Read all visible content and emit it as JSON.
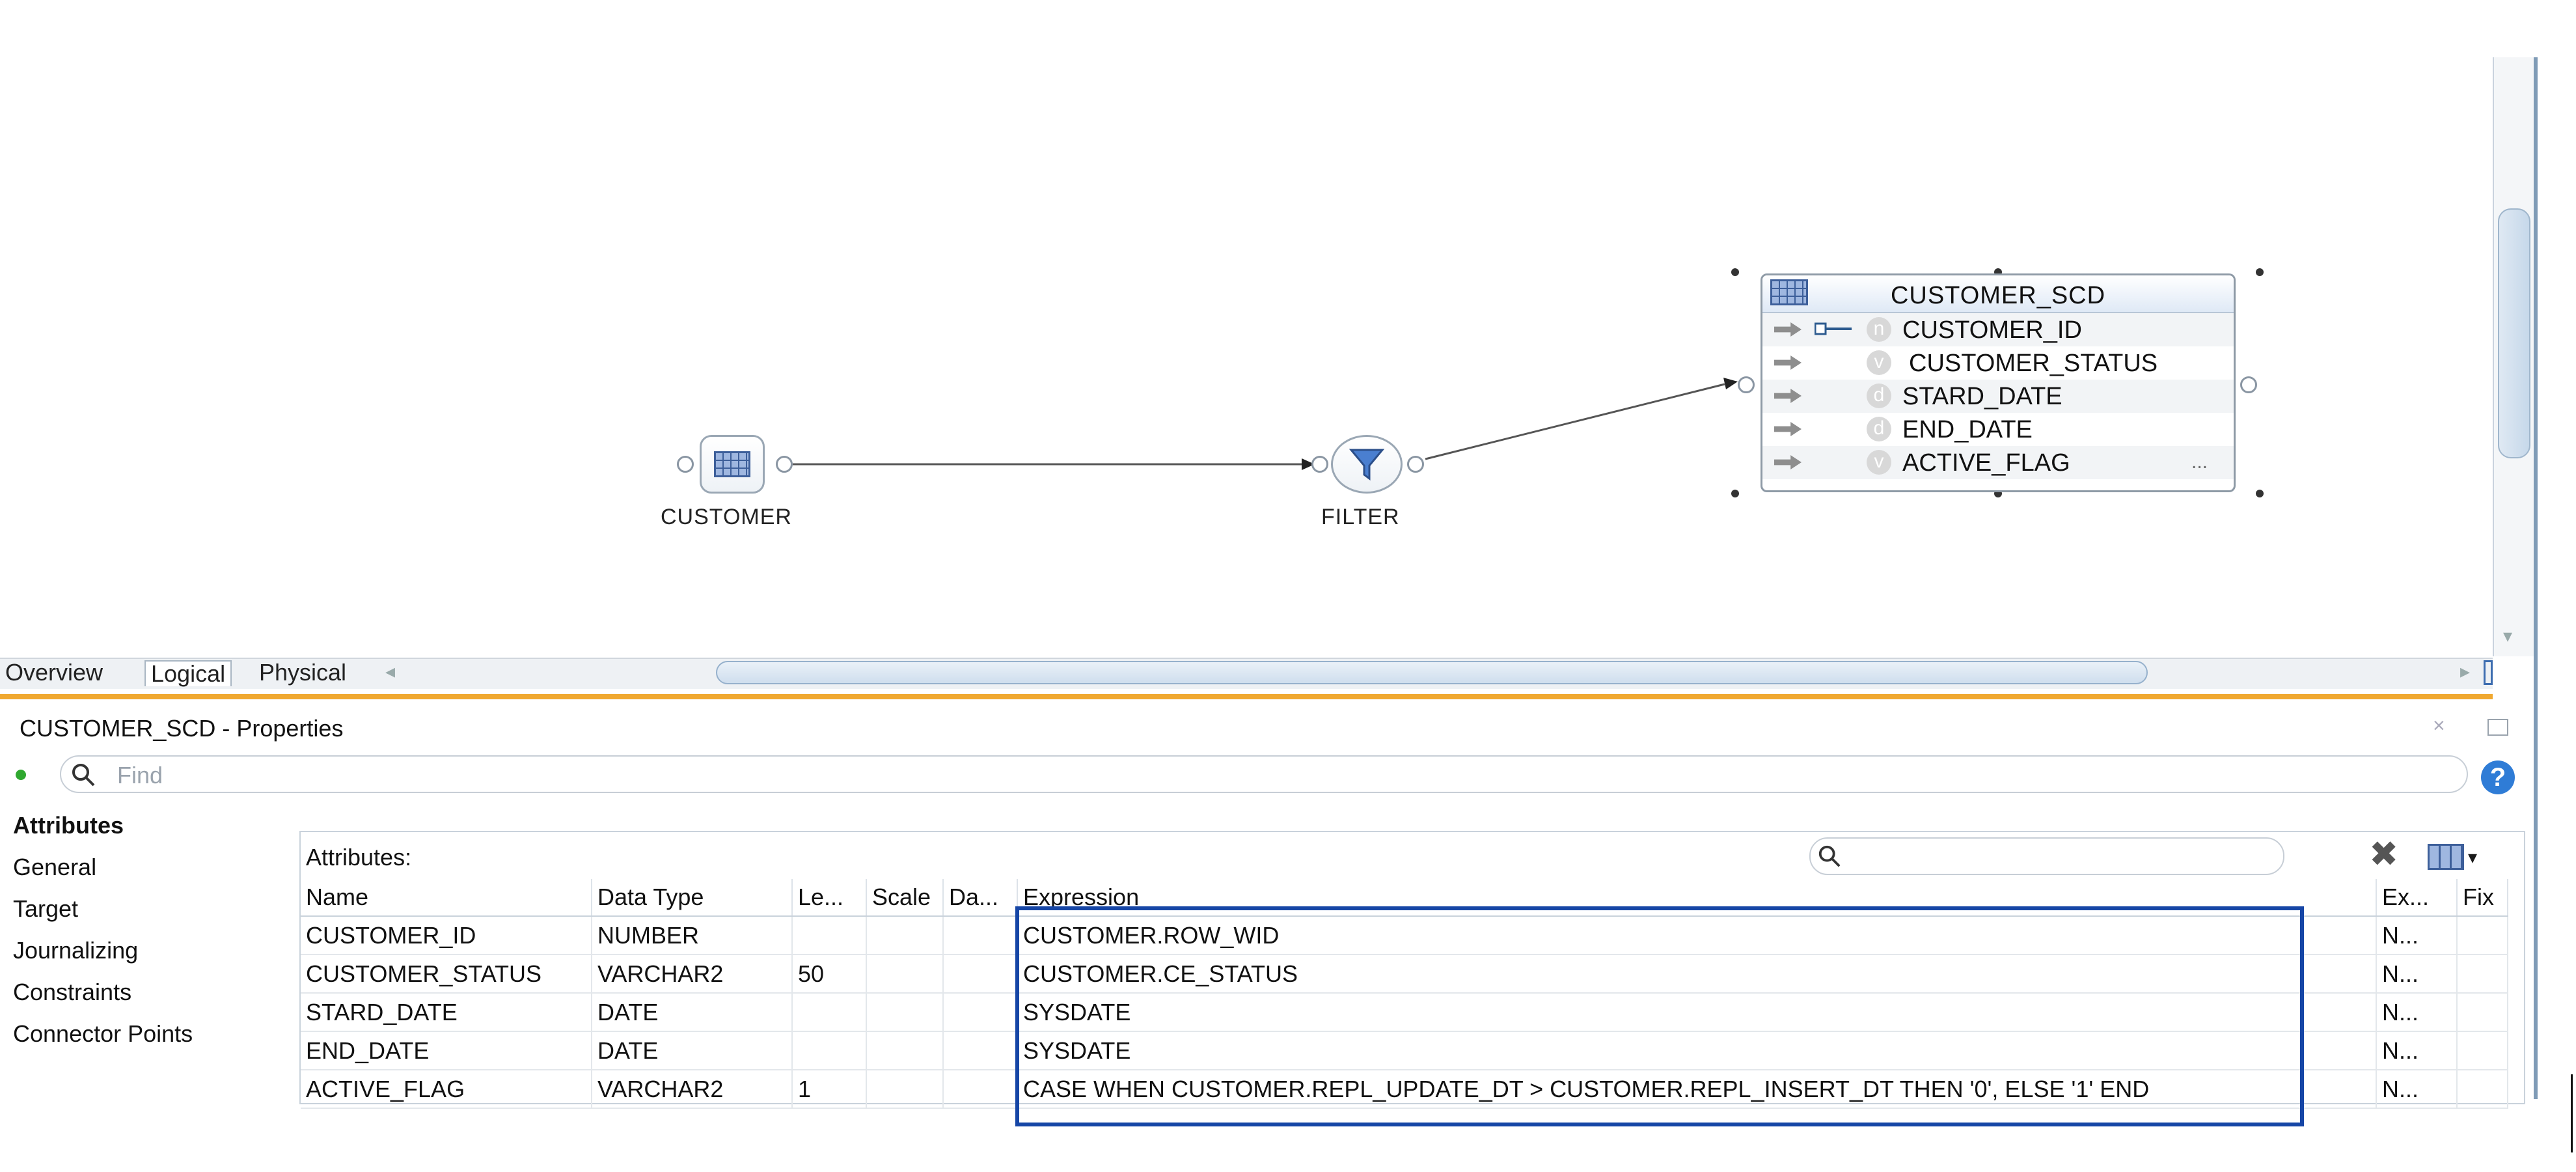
{
  "canvas": {
    "source_node": {
      "label": "CUSTOMER"
    },
    "filter_node": {
      "label": "FILTER"
    },
    "target_datastore": {
      "title": "CUSTOMER_SCD",
      "rows": [
        {
          "type": "n",
          "name": "CUSTOMER_ID"
        },
        {
          "type": "v",
          "name": "CUSTOMER_STATUS"
        },
        {
          "type": "d",
          "name": "STARD_DATE"
        },
        {
          "type": "d",
          "name": "END_DATE"
        },
        {
          "type": "v",
          "name": "ACTIVE_FLAG"
        }
      ],
      "more": "..."
    }
  },
  "tabs": [
    "Overview",
    "Logical",
    "Physical"
  ],
  "properties": {
    "title": "CUSTOMER_SCD - Properties",
    "find_placeholder": "Find",
    "nav": [
      "Attributes",
      "General",
      "Target",
      "Journalizing",
      "Constraints",
      "Connector Points"
    ],
    "attributes_label": "Attributes:",
    "columns": [
      "Name",
      "Data Type",
      "Le...",
      "Scale",
      "Da...",
      "Expression",
      "Ex...",
      "Fix"
    ],
    "rows": [
      {
        "name": "CUSTOMER_ID",
        "type": "NUMBER",
        "len": "",
        "scale": "",
        "da": "",
        "expr": "CUSTOMER.ROW_WID",
        "ex": "N...",
        "fix": ""
      },
      {
        "name": "CUSTOMER_STATUS",
        "type": "VARCHAR2",
        "len": "50",
        "scale": "",
        "da": "",
        "expr": "CUSTOMER.CE_STATUS",
        "ex": "N...",
        "fix": ""
      },
      {
        "name": "STARD_DATE",
        "type": "DATE",
        "len": "",
        "scale": "",
        "da": "",
        "expr": "SYSDATE",
        "ex": "N...",
        "fix": ""
      },
      {
        "name": "END_DATE",
        "type": "DATE",
        "len": "",
        "scale": "",
        "da": "",
        "expr": "SYSDATE",
        "ex": "N...",
        "fix": ""
      },
      {
        "name": "ACTIVE_FLAG",
        "type": "VARCHAR2",
        "len": "1",
        "scale": "",
        "da": "",
        "expr": "CASE WHEN CUSTOMER.REPL_UPDATE_DT > CUSTOMER.REPL_INSERT_DT THEN '0', ELSE '1' END",
        "ex": "N...",
        "fix": ""
      }
    ]
  },
  "colors": {
    "highlight": "#1646a6",
    "accent_bar": "#f0a830",
    "help": "#2f7cd6"
  }
}
